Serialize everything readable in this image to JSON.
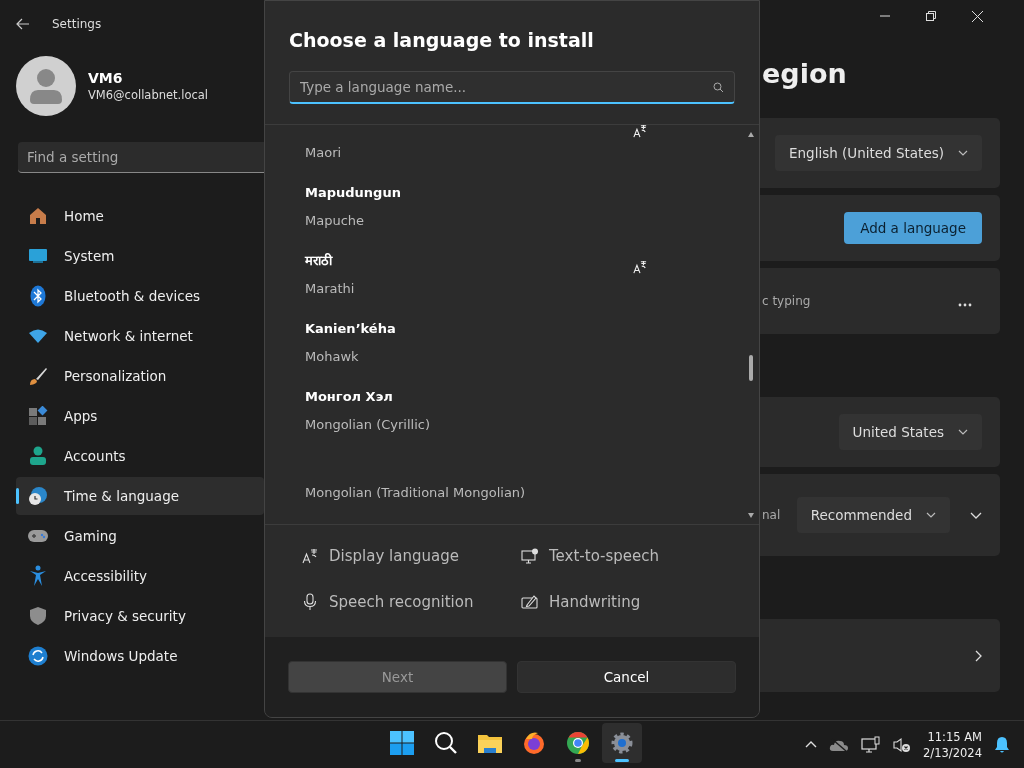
{
  "window": {
    "title": "Settings"
  },
  "user": {
    "name": "VM6",
    "email": "VM6@collabnet.local"
  },
  "search": {
    "placeholder": "Find a setting"
  },
  "nav": [
    {
      "label": "Home",
      "selected": false
    },
    {
      "label": "System",
      "selected": false
    },
    {
      "label": "Bluetooth & devices",
      "selected": false
    },
    {
      "label": "Network & internet",
      "selected": false
    },
    {
      "label": "Personalization",
      "selected": false
    },
    {
      "label": "Apps",
      "selected": false
    },
    {
      "label": "Accounts",
      "selected": false
    },
    {
      "label": "Time & language",
      "selected": true
    },
    {
      "label": "Gaming",
      "selected": false
    },
    {
      "label": "Accessibility",
      "selected": false
    },
    {
      "label": "Privacy & security",
      "selected": false
    },
    {
      "label": "Windows Update",
      "selected": false
    }
  ],
  "page": {
    "title": "egion",
    "cards": [
      {
        "kind": "dropdown",
        "value": "English (United States)"
      },
      {
        "kind": "button",
        "label": "Add a language"
      },
      {
        "kind": "more",
        "text": "c typing"
      },
      {
        "kind": "dropdown",
        "value": "United States"
      },
      {
        "kind": "dropdown_expand",
        "text": "nal",
        "value": "Recommended"
      },
      {
        "kind": "link"
      }
    ]
  },
  "dialog": {
    "title": "Choose a language to install",
    "search_placeholder": "Type a language name...",
    "languages": [
      {
        "english": "Maori",
        "display_language": true
      },
      {
        "native": "Mapudungun",
        "english": "Mapuche",
        "display_language": false
      },
      {
        "native": "मराठी",
        "english": "Marathi",
        "display_language": true
      },
      {
        "native": "Kanien’kéha",
        "english": "Mohawk",
        "display_language": false
      },
      {
        "native": "Монгол Хэл",
        "english": "Mongolian (Cyrillic)",
        "display_language": false
      },
      {
        "english": "Mongolian (Traditional Mongolian)",
        "display_language": false
      }
    ],
    "features": [
      {
        "label": "Display language"
      },
      {
        "label": "Text-to-speech"
      },
      {
        "label": "Speech recognition"
      },
      {
        "label": "Handwriting"
      }
    ],
    "buttons": [
      {
        "label": "Next",
        "disabled": true
      },
      {
        "label": "Cancel",
        "disabled": false
      }
    ]
  },
  "taskbar": {
    "apps": [
      {
        "running": false,
        "active": false
      },
      {
        "running": false,
        "active": false
      },
      {
        "running": false,
        "active": false
      },
      {
        "running": false,
        "active": false
      },
      {
        "running": true,
        "active": false
      },
      {
        "running": true,
        "active": true
      }
    ],
    "time": "11:15 AM",
    "date": "2/13/2024"
  }
}
